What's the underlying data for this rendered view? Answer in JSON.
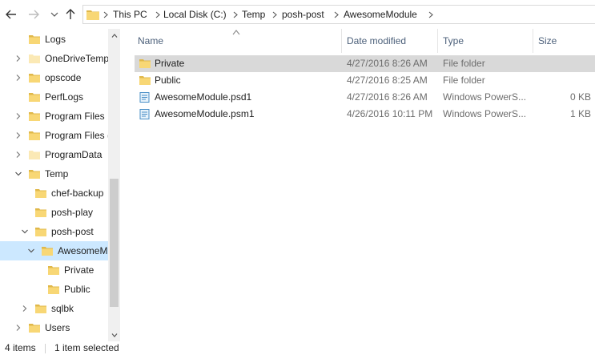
{
  "breadcrumb": [
    "This PC",
    "Local Disk (C:)",
    "Temp",
    "posh-post",
    "AwesomeModule"
  ],
  "nav_tree": [
    {
      "label": "Logs",
      "expander": "none",
      "icon": "folder"
    },
    {
      "label": "OneDriveTemp",
      "expander": "collapsed",
      "icon": "folder-faded"
    },
    {
      "label": "opscode",
      "expander": "collapsed",
      "icon": "folder"
    },
    {
      "label": "PerfLogs",
      "expander": "none",
      "icon": "folder"
    },
    {
      "label": "Program Files",
      "expander": "collapsed",
      "icon": "folder"
    },
    {
      "label": "Program Files (",
      "expander": "collapsed",
      "icon": "folder"
    },
    {
      "label": "ProgramData",
      "expander": "collapsed",
      "icon": "folder-faded"
    },
    {
      "label": "Temp",
      "expander": "expanded",
      "icon": "folder"
    },
    {
      "label": "chef-backup",
      "expander": "none",
      "icon": "folder"
    },
    {
      "label": "posh-play",
      "expander": "none",
      "icon": "folder"
    },
    {
      "label": "posh-post",
      "expander": "expanded",
      "icon": "folder"
    },
    {
      "label": "AwesomeM",
      "expander": "expanded",
      "icon": "folder",
      "selected": true
    },
    {
      "label": "Private",
      "expander": "none",
      "icon": "folder"
    },
    {
      "label": "Public",
      "expander": "none",
      "icon": "folder"
    },
    {
      "label": "sqlbk",
      "expander": "collapsed",
      "icon": "folder"
    },
    {
      "label": "Users",
      "expander": "collapsed",
      "icon": "folder"
    }
  ],
  "columns": {
    "name": "Name",
    "date_modified": "Date modified",
    "type": "Type",
    "size": "Size"
  },
  "files": [
    {
      "name": "Private",
      "date": "4/27/2016 8:26 AM",
      "type": "File folder",
      "size": "",
      "icon": "folder",
      "selected": true
    },
    {
      "name": "Public",
      "date": "4/27/2016 8:25 AM",
      "type": "File folder",
      "size": "",
      "icon": "folder"
    },
    {
      "name": "AwesomeModule.psd1",
      "date": "4/27/2016 8:26 AM",
      "type": "Windows PowerS...",
      "size": "0 KB",
      "icon": "script-file"
    },
    {
      "name": "AwesomeModule.psm1",
      "date": "4/26/2016 10:11 PM",
      "type": "Windows PowerS...",
      "size": "1 KB",
      "icon": "script-file"
    }
  ],
  "status": {
    "item_count": "4 items",
    "selection": "1 item selected"
  },
  "colors": {
    "folder": "#f8d775",
    "folder_dark": "#e0b84a",
    "folder_faded": "#fbe9b5",
    "selected_nav": "#cce8ff",
    "selected_row": "#d9d9d9",
    "header_text": "#4c607a"
  }
}
